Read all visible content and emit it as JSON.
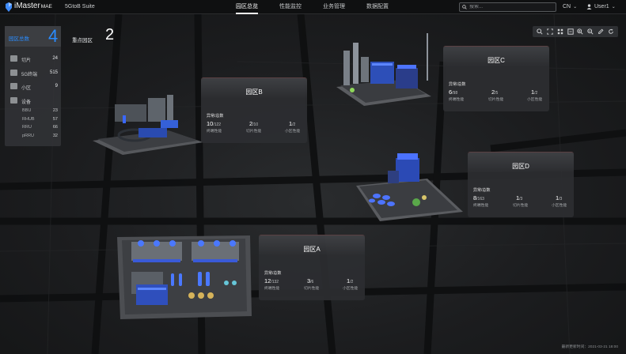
{
  "header": {
    "brand_main": "iMaster",
    "brand_sub": "MAE",
    "suite": "5GtoB Suite",
    "nav": [
      {
        "label": "园区总览",
        "active": true
      },
      {
        "label": "性能监控",
        "active": false
      },
      {
        "label": "业务管理",
        "active": false
      },
      {
        "label": "数据配置",
        "active": false
      }
    ],
    "search_placeholder": "搜索...",
    "lang": "CN",
    "user": "User1"
  },
  "summary": {
    "zone_total_label": "园区总数",
    "zone_total": "4",
    "key_zone_label": "重点园区",
    "key_zone_count": "2",
    "rows": [
      {
        "label": "切片",
        "value": "24",
        "icon": "slice-icon"
      },
      {
        "label": "5G终端",
        "value": "515",
        "icon": "terminal-icon"
      },
      {
        "label": "小区",
        "value": "9",
        "icon": "cell-icon"
      },
      {
        "label": "设备",
        "value": "",
        "icon": "device-icon"
      }
    ],
    "devices": [
      {
        "label": "BBU",
        "value": "23"
      },
      {
        "label": "RHUB",
        "value": "57"
      },
      {
        "label": "RRU",
        "value": "66"
      },
      {
        "label": "pRRU",
        "value": "32"
      }
    ]
  },
  "toolbar": {
    "buttons": [
      "search-icon",
      "fit-icon",
      "grid-icon",
      "expand-icon",
      "zoom-in-icon",
      "zoom-out-icon",
      "edit-icon",
      "refresh-icon"
    ]
  },
  "zones": [
    {
      "id": "c",
      "title": "园区C",
      "sub": "异常/总数",
      "stats": [
        {
          "num": "6",
          "total": "/98",
          "label": "终端性能"
        },
        {
          "num": "2",
          "total": "/5",
          "label": "切片性能"
        },
        {
          "num": "1",
          "total": "/2",
          "label": "小区性能"
        }
      ]
    },
    {
      "id": "b",
      "title": "园区B",
      "sub": "异常/总数",
      "stats": [
        {
          "num": "10",
          "total": "/122",
          "label": "终端性能"
        },
        {
          "num": "2",
          "total": "/10",
          "label": "切片性能"
        },
        {
          "num": "1",
          "total": "/2",
          "label": "小区性能"
        }
      ]
    },
    {
      "id": "d",
      "title": "园区D",
      "sub": "异常/总数",
      "stats": [
        {
          "num": "8",
          "total": "/163",
          "label": "终端性能"
        },
        {
          "num": "1",
          "total": "/3",
          "label": "切片性能"
        },
        {
          "num": "1",
          "total": "/3",
          "label": "小区性能"
        }
      ]
    },
    {
      "id": "a",
      "title": "园区A",
      "sub": "异常/总数",
      "stats": [
        {
          "num": "12",
          "total": "/132",
          "label": "终端性能"
        },
        {
          "num": "3",
          "total": "/6",
          "label": "切片性能"
        },
        {
          "num": "1",
          "total": "/2",
          "label": "小区性能"
        }
      ]
    }
  ],
  "footer": "最新更新时间：2021-03-21 18:00",
  "colors": {
    "accent": "#2a8cff",
    "alarm": "#e0474c"
  }
}
